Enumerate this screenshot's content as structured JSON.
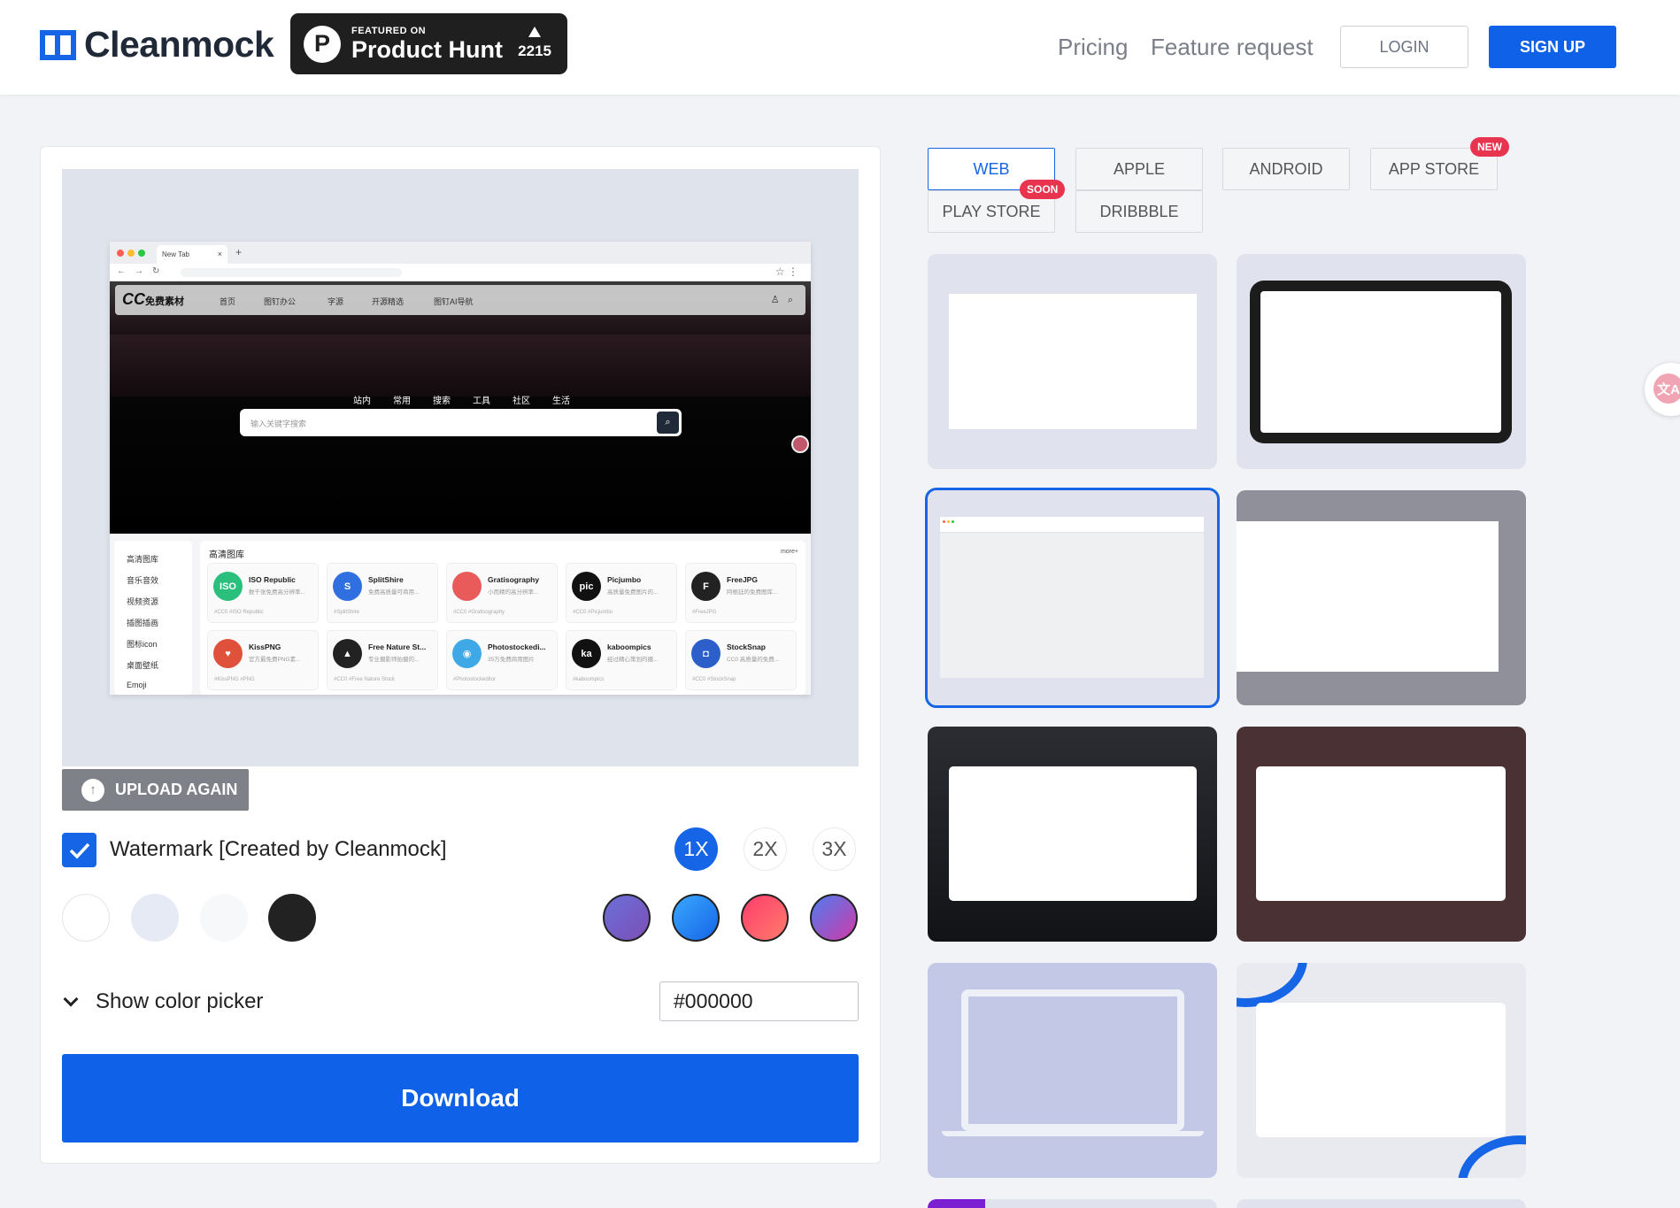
{
  "header": {
    "logo_text": "Cleanmock",
    "producthunt": {
      "featured": "FEATURED ON",
      "name": "Product Hunt",
      "count": "2215"
    },
    "nav": {
      "pricing": "Pricing",
      "feature_request": "Feature request"
    },
    "login": "LOGIN",
    "signup": "SIGN UP"
  },
  "preview": {
    "browser": {
      "tab_title": "New Tab"
    },
    "site": {
      "logo": "CC",
      "logo_suffix": "免费素材",
      "nav": [
        "首页",
        "图钉办公",
        "字源",
        "开源精选",
        "图钉AI导航"
      ],
      "hero_tabs": [
        "站内",
        "常用",
        "搜索",
        "工具",
        "社区",
        "生活"
      ],
      "search_placeholder": "输入关键字搜索",
      "sidebar": [
        "高清图库",
        "音乐音效",
        "视频资源",
        "插图插画",
        "图标icon",
        "桌面壁纸",
        "Emoji"
      ],
      "section_title": "高清图库",
      "more": "more+",
      "resources": [
        {
          "name": "ISO Republic",
          "desc": "数千张免费高分辨率...",
          "tags": "#CC0  #ISO Republic",
          "icon_text": "ISO",
          "color": "#2bbf7e"
        },
        {
          "name": "SplitShire",
          "desc": "免费高质量可商用...",
          "tags": "#SplitShire",
          "icon_text": "S",
          "color": "#2f6fe0"
        },
        {
          "name": "Gratisography",
          "desc": "小而精的高分辨率...",
          "tags": "#CC0  #Gratisography",
          "icon_text": "",
          "color": "#e95a5a"
        },
        {
          "name": "Picjumbo",
          "desc": "高质量免费图片的...",
          "tags": "#CC0  #Picjumbo",
          "icon_text": "pic",
          "color": "#111111"
        },
        {
          "name": "FreeJPG",
          "desc": "阿根廷的免费图库...",
          "tags": "#FreeJPG",
          "icon_text": "F",
          "color": "#222222"
        },
        {
          "name": "KissPNG",
          "desc": "官方最免费PNG素...",
          "tags": "#KissPNG  #PNG",
          "icon_text": "♥",
          "color": "#e0513c"
        },
        {
          "name": "Free Nature St...",
          "desc": "专业摄影师拍摄的...",
          "tags": "#CC0  #Free Nature Stock",
          "icon_text": "▲",
          "color": "#222222"
        },
        {
          "name": "Photostockedi...",
          "desc": "35万免费商用图片",
          "tags": "#Photostockeditor",
          "icon_text": "◉",
          "color": "#3fa9e8"
        },
        {
          "name": "kaboompics",
          "desc": "经过精心策划的摄...",
          "tags": "#kaboompics",
          "icon_text": "ka",
          "color": "#111111"
        },
        {
          "name": "StockSnap",
          "desc": "CC0 高质量的免费...",
          "tags": "#CC0  #StockSnap",
          "icon_text": "◘",
          "color": "#2c5fc9"
        }
      ]
    }
  },
  "controls": {
    "upload_again": "UPLOAD AGAIN",
    "watermark_label": "Watermark [Created by Cleanmock]",
    "watermark_checked": true,
    "scales": [
      "1X",
      "2X",
      "3X"
    ],
    "selected_scale": "1X",
    "color_picker_label": "Show color picker",
    "hex_value": "#000000",
    "download": "Download",
    "swatches": [
      "#ffffff",
      "#e6eaf4",
      "#f7f8f9",
      "#222222",
      "linear-gradient(135deg,#6c6fd9,#7b4fb5)",
      "linear-gradient(135deg,#3aa8ff,#1565e6)",
      "linear-gradient(135deg,#ff3d6d,#ff7b6b)",
      "linear-gradient(135deg,#4f7cf0,#d13aa8)"
    ]
  },
  "device_tabs": [
    {
      "label": "WEB",
      "active": true,
      "badge": "SOON"
    },
    {
      "label": "APPLE",
      "active": false
    },
    {
      "label": "ANDROID",
      "active": false
    },
    {
      "label": "APP STORE",
      "active": false,
      "badge": "NEW"
    },
    {
      "label": "PLAY STORE",
      "active": false
    },
    {
      "label": "DRIBBBLE",
      "active": false
    }
  ],
  "colors": {
    "accent": "#1565e6",
    "badge": "#e8344e",
    "upload_bg": "#7e8188"
  }
}
